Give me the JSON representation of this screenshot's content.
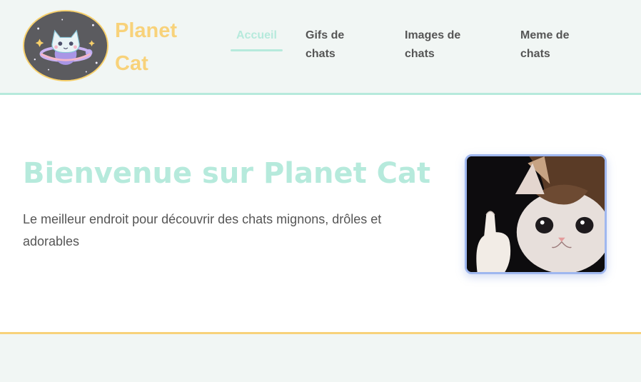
{
  "brand": {
    "line1": "Planet",
    "line2": "Cat"
  },
  "nav": {
    "items": [
      {
        "label": "Accueil",
        "active": true
      },
      {
        "label": "Gifs de",
        "label2": "chats"
      },
      {
        "label": "Images de",
        "label2": "chats"
      },
      {
        "label": "Meme de",
        "label2": "chats"
      }
    ]
  },
  "hero": {
    "title": "Bienvenue sur Planet Cat",
    "subtitle": "Le meilleur endroit pour découvrir des chats mignons, drôles et adorables"
  },
  "colors": {
    "mint": "#b6eadc",
    "yellow": "#f8d27a",
    "text": "#555555",
    "header_bg": "#f1f6f4",
    "image_border": "#9fb7ef"
  },
  "icons": {
    "logo": "planet-cat-logo-icon",
    "hero_image": "crying-cat-thumbs-up-image"
  }
}
